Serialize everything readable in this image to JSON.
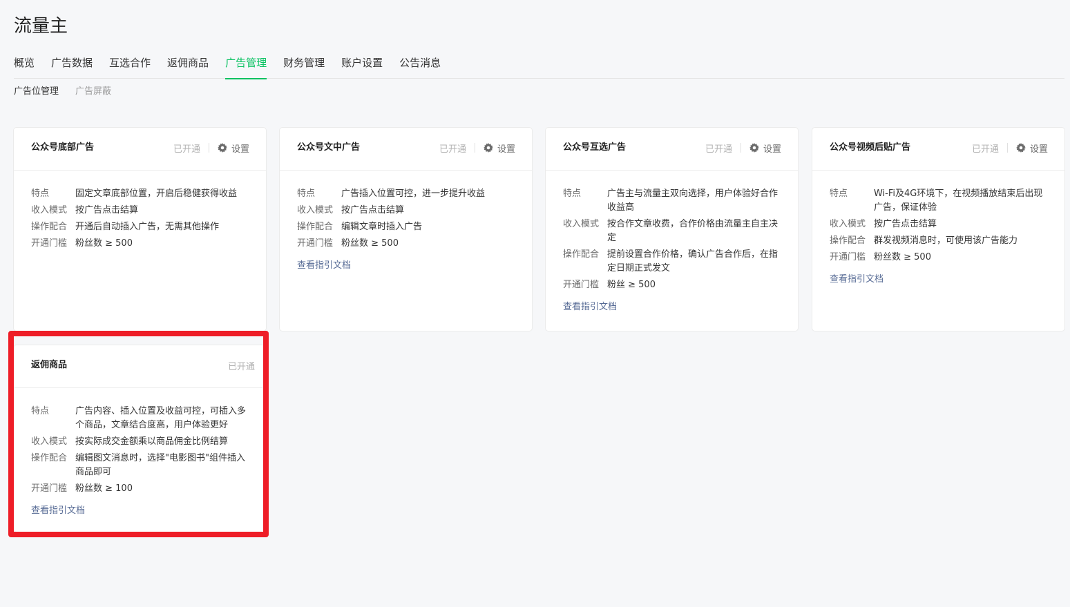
{
  "page": {
    "title": "流量主"
  },
  "main_tabs": [
    {
      "label": "概览"
    },
    {
      "label": "广告数据"
    },
    {
      "label": "互选合作"
    },
    {
      "label": "返佣商品"
    },
    {
      "label": "广告管理",
      "active": true
    },
    {
      "label": "财务管理"
    },
    {
      "label": "账户设置"
    },
    {
      "label": "公告消息"
    }
  ],
  "sub_tabs": [
    {
      "label": "广告位管理",
      "active": true
    },
    {
      "label": "广告屏蔽"
    }
  ],
  "row_labels": {
    "feature": "特点",
    "income": "收入模式",
    "operation": "操作配合",
    "threshold": "开通门槛"
  },
  "cards": [
    {
      "title": "公众号底部广告",
      "status": "已开通",
      "settings_label": "设置",
      "feature": "固定文章底部位置，开启后稳健获得收益",
      "income": "按广告点击结算",
      "operation": "开通后自动插入广告，无需其他操作",
      "threshold": "粉丝数 ≥ 500"
    },
    {
      "title": "公众号文中广告",
      "status": "已开通",
      "settings_label": "设置",
      "feature": "广告插入位置可控，进一步提升收益",
      "income": "按广告点击结算",
      "operation": "编辑文章时插入广告",
      "threshold": "粉丝数 ≥ 500",
      "guide_link": "查看指引文档"
    },
    {
      "title": "公众号互选广告",
      "status": "已开通",
      "settings_label": "设置",
      "feature": "广告主与流量主双向选择，用户体验好合作收益高",
      "income": "按合作文章收费，合作价格由流量主自主决定",
      "operation": "提前设置合作价格，确认广告合作后，在指定日期正式发文",
      "threshold": "粉丝 ≥ 500",
      "guide_link": "查看指引文档"
    },
    {
      "title": "公众号视频后贴广告",
      "status": "已开通",
      "settings_label": "设置",
      "feature": "Wi-Fi及4G环境下，在视频播放结束后出现广告，保证体验",
      "income": "按广告点击结算",
      "operation": "群发视频消息时，可使用该广告能力",
      "threshold": "粉丝数 ≥ 500",
      "guide_link": "查看指引文档"
    },
    {
      "title": "返佣商品",
      "status": "已开通",
      "feature": "广告内容、插入位置及收益可控，可插入多个商品，文章结合度高，用户体验更好",
      "income": "按实际成交金额乘以商品佣金比例结算",
      "operation": "编辑图文消息时，选择\"电影图书\"组件插入商品即可",
      "threshold": "粉丝数 ≥ 100",
      "guide_link": "查看指引文档"
    }
  ],
  "colors": {
    "accent": "#07c160",
    "link": "#576b95",
    "highlight": "#ee1d27"
  }
}
